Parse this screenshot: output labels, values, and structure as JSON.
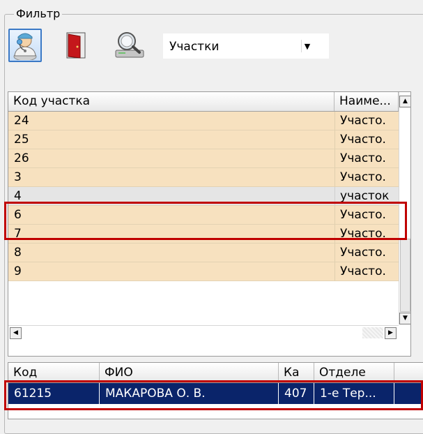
{
  "filter": {
    "title": "Фильтр",
    "toolbar": {
      "buttons": [
        {
          "icon": "doctor-icon",
          "pressed": true
        },
        {
          "icon": "door-exit-icon",
          "pressed": false
        },
        {
          "icon": "search-computer-icon",
          "pressed": false
        }
      ]
    },
    "combo": {
      "value": "Участки",
      "arrow": "▼"
    }
  },
  "sections_grid": {
    "columns": [
      "Код участка",
      "Наиме..."
    ],
    "rows": [
      {
        "code": "24",
        "name": "Участо."
      },
      {
        "code": "25",
        "name": "Участо."
      },
      {
        "code": "26",
        "name": "Участо."
      },
      {
        "code": "3",
        "name": "Участо."
      },
      {
        "code": "4",
        "name": "участок"
      },
      {
        "code": "6",
        "name": "Участо."
      },
      {
        "code": "7",
        "name": "Участо."
      },
      {
        "code": "8",
        "name": "Участо."
      },
      {
        "code": "9",
        "name": "Участо."
      }
    ],
    "selected_code": "4",
    "scroll_up": "▲",
    "scroll_down": "▼",
    "scroll_left": "◀",
    "scroll_right": "▶"
  },
  "doctors_grid": {
    "columns": [
      "Код",
      "ФИО",
      "Ка",
      "Отделе"
    ],
    "selected_row": {
      "code": "61215",
      "fio": "МАКАРОВА О. В.",
      "cab": "407",
      "dept": "1-е Тер..."
    }
  },
  "colors": {
    "row_bg": "#f7e1bf",
    "selected_row_bg": "#0a246a",
    "highlight": "#c00000"
  }
}
